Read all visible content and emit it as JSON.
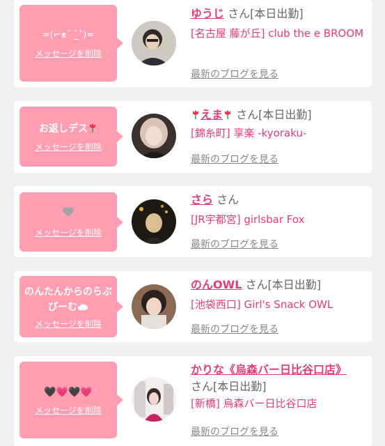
{
  "cards": [
    {
      "message": "=(⌐ᴥ´ _̀˃)=",
      "delete_label": "メッセージを削除",
      "name": "ゆうじ",
      "suffix": "さん[本日出勤]",
      "shop": "[名古屋 藤が丘] club the e BROOM",
      "blog_label": "最新のブログを見る"
    },
    {
      "message": "お返しデス",
      "delete_label": "メッセージを削除",
      "name": "えま",
      "suffix": "さん[本日出勤]",
      "shop": "[錦糸町] 享楽 -kyoraku-",
      "blog_label": "最新のブログを見る"
    },
    {
      "message": "🩶",
      "delete_label": "メッセージを削除",
      "name": "さら",
      "suffix": "さん",
      "shop": "[JR宇都宮] girlsbar Fox",
      "blog_label": "最新のブログを見る"
    },
    {
      "message": "のんたんからのらぶびーむ",
      "delete_label": "メッセージを削除",
      "name": "のんOWL",
      "suffix": "さん[本日出勤]",
      "shop": "[池袋西口] Girl's Snack OWL",
      "blog_label": "最新のブログを見る"
    },
    {
      "message": "🖤💗🖤💗",
      "delete_label": "メッセージを削除",
      "name": "かりな《烏森バー日比谷口店》",
      "suffix": "さん[本日出勤]",
      "shop": "[新橋] 烏森バー日比谷口店",
      "blog_label": "最新のブログを見る"
    }
  ]
}
